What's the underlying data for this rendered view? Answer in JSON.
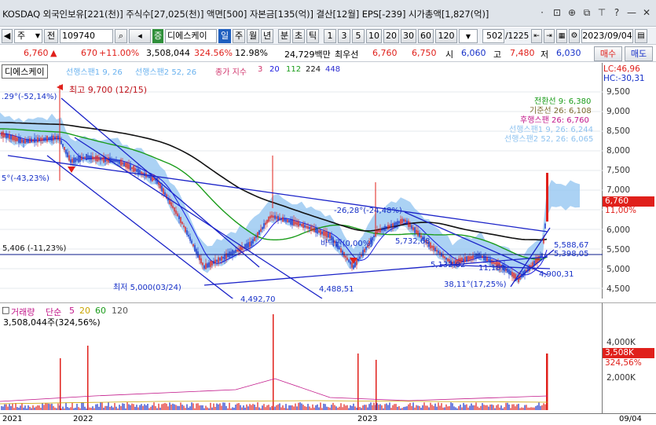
{
  "title_bar": {
    "text": "KOSDAQ 외국인보유[221(천)] 주식수[27,025(천)] 액면[500] 자본금[135(억)] 결산[12월] EPS[-239] 시가총액[1,827(억)]",
    "icons": [
      "dropdown-dot-icon",
      "window-icon",
      "zoom-icon",
      "restore-icon",
      "pin-icon",
      "help-icon",
      "minimize-icon",
      "close-icon"
    ],
    "icon_glyphs": [
      "·",
      "⊡",
      "⊕",
      "⧉",
      "⊤",
      "?",
      "—",
      "✕"
    ]
  },
  "toolbar": {
    "market_selector": "주",
    "prev_label": "◀",
    "next_label": "전",
    "code": "109740",
    "search_icon_glyph": "⌕",
    "speaker_icon_glyph": "◂",
    "badge": "증",
    "stock_name": "디에스케이",
    "periods": [
      "일",
      "주",
      "월",
      "년",
      "분",
      "초",
      "틱"
    ],
    "active_period": "일",
    "intervals": [
      "1",
      "3",
      "5",
      "10",
      "20",
      "30",
      "60",
      "120"
    ],
    "count": "502",
    "total": "/1225",
    "date": "2023/09/04"
  },
  "price_bar": {
    "price": "6,760",
    "arrow": "▲",
    "change": "670",
    "change_pct": "+11.00%",
    "volume": "3,508,044",
    "vol_pct": "324.56%",
    "turnover": "12.98%",
    "trade_value": "24,729백만",
    "best_ask_label": "최우선",
    "best_ask": "6,760",
    "best_bid": "6,750",
    "open_label": "시",
    "open": "6,060",
    "high_label": "고",
    "high": "7,480",
    "low_label": "저",
    "low": "6,030",
    "buy_label": "매수",
    "sell_label": "매도"
  },
  "legend": {
    "name": "디에스케이",
    "span1": "선행스팬1 9, 26",
    "span2": "선행스팬2 52, 26",
    "ma_label": "종가 지수",
    "ma_values": [
      "3",
      "20",
      "112",
      "224",
      "448"
    ]
  },
  "indicators": {
    "conversion": "전환선 9: 6,380",
    "base": "기준선 26: 6,108",
    "lagging": "후행스팬 26: 6,760",
    "span1": "선행스팬1 9, 26: 6,244",
    "span2": "선행스팬2 52, 26: 6,065"
  },
  "annotations": {
    "high": "최고 9,700 (12/15)",
    "left_pct": ".29°(-52,14%)",
    "left_pct2": "5°(-43,23%)",
    "support": "5,406 (-11,23%)",
    "low": "최저 5,000(03/24)",
    "angle1": "-26,28°(-24,48%)",
    "rebound": "바닥권(0,00%)",
    "v1": "5,732,68",
    "v2": "5,132,02",
    "v3": "11,18%",
    "v4": "4,488,51",
    "v5": "38,11°(17,25%)",
    "v6": "5,588,67",
    "v7": "5,398,05",
    "v8": "4,900,31",
    "v9": "4,492,70",
    "lc": "LC:46,96",
    "hc": "HC:-30,31"
  },
  "price_axis": [
    "9,500",
    "9,000",
    "8,500",
    "8,000",
    "7,500",
    "7,000",
    "6,500",
    "6,000",
    "5,500",
    "5,000",
    "4,500"
  ],
  "current_tag": {
    "price": "6,760",
    "pct": "11,00%"
  },
  "volume": {
    "legend_label": "거래량",
    "legend_type": "단순",
    "ma_values": [
      "5",
      "20",
      "60",
      "120"
    ],
    "current": "3,508,044주(324,56%)",
    "axis": [
      "4,000K",
      "2,000K"
    ],
    "tag_value": "3,508K",
    "tag_pct": "324,56%"
  },
  "date_axis": [
    "2021",
    "2022",
    "2023",
    "09/04"
  ],
  "colors": {
    "up": "#e0201b",
    "down": "#1630c8",
    "cloud": "#8fc3f0",
    "ma20": "#1a1ae0",
    "ma112": "#1a9c1a",
    "ma224": "#111111",
    "ma448": "#2b2bd0"
  }
}
